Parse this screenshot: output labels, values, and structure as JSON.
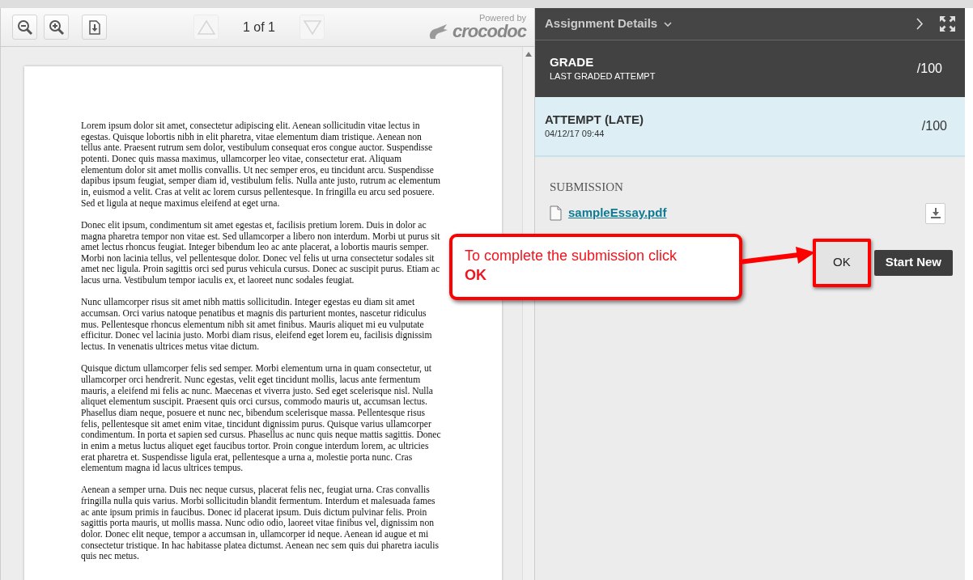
{
  "viewer": {
    "toolbar": {
      "page_indicator": "1 of 1",
      "prev_disabled": true,
      "next_disabled": true,
      "powered_by": "Powered by",
      "brand": "crocodoc"
    },
    "document": {
      "paragraphs": [
        "Lorem ipsum dolor sit amet, consectetur adipiscing elit. Aenean sollicitudin vitae lectus in egestas. Quisque lobortis nibh in elit pharetra, vitae elementum diam tristique. Aenean non tellus ante. Praesent rutrum sem dolor, vestibulum consequat eros congue auctor. Suspendisse potenti. Donec quis massa maximus, ullamcorper leo vitae, consectetur erat. Aliquam elementum dolor sit amet mollis convallis. Ut nec semper eros, eu tincidunt arcu. Suspendisse dapibus ipsum feugiat, semper diam id, vestibulum felis. Nulla ante justo, rutrum ac elementum in, euismod a velit. Cras at velit ac lorem cursus pellentesque. In fringilla eu arcu sed posuere. Sed et ligula at neque maximus eleifend at eget urna.",
        "Donec elit ipsum, condimentum sit amet egestas et, facilisis pretium lorem. Duis in dolor ac magna pharetra tempor non vitae est. Sed ullamcorper a libero non interdum. Morbi ut purus sit amet lectus rhoncus feugiat. Integer bibendum leo ac ante placerat, a lobortis mauris semper. Morbi non lacinia tellus, vel pellentesque dolor. Donec vel felis ut urna consectetur sodales sit amet nec ligula. Proin sagittis orci sed purus vehicula cursus. Donec ac suscipit purus. Etiam ac lacus urna. Vestibulum tempor iaculis ex, et laoreet nunc sodales feugiat.",
        "Nunc ullamcorper risus sit amet nibh mattis sollicitudin. Integer egestas eu diam sit amet accumsan. Orci varius natoque penatibus et magnis dis parturient montes, nascetur ridiculus mus. Pellentesque rhoncus elementum nibh sit amet finibus. Mauris aliquet mi eu vulputate efficitur. Donec vel lacinia justo. Morbi diam risus, eleifend eget lorem eu, facilisis dignissim lectus. In venenatis ultrices metus vitae dictum.",
        "Quisque dictum ullamcorper felis sed semper. Morbi elementum urna in quam consectetur, ut ullamcorper orci hendrerit. Nunc egestas, velit eget tincidunt mollis, lacus ante fermentum mauris, a eleifend mi felis ac nunc. Maecenas et viverra justo. Sed eget scelerisque nisl. Nulla aliquet elementum suscipit. Praesent quis orci cursus, commodo mauris ut, accumsan lectus. Phasellus diam neque, posuere et nunc nec, bibendum scelerisque massa. Pellentesque risus felis, pellentesque sit amet enim vitae, tincidunt dignissim purus. Quisque varius ullamcorper condimentum. In porta et sapien sed cursus. Phasellus ac nunc quis neque mattis sagittis. Donec in enim a metus luctus aliquet eget faucibus tortor. Proin congue interdum lorem, ac ultricies erat pharetra et. Suspendisse ligula erat, pellentesque a urna a, molestie porta nunc. Cras elementum magna id lacus ultrices tempus.",
        "Aenean a semper urna. Duis nec neque cursus, placerat felis nec, feugiat urna. Cras convallis fringilla nulla quis varius. Morbi sollicitudin blandit fermentum. Interdum et malesuada fames ac ante ipsum primis in faucibus. Donec id placerat ipsum. Duis dictum pulvinar felis. Proin sagittis porta mauris, ut mollis massa. Nunc odio odio, laoreet vitae finibus vel, dignissim non dolor. Donec elit neque, tempor a accumsan in, ullamcorper id neque. Aenean id augue et mi consectetur tristique. In hac habitasse platea dictumst. Aenean nec sem quis dui pharetra iaculis quis nec metus."
      ]
    }
  },
  "panel": {
    "title": "Assignment Details",
    "grade": {
      "label": "GRADE",
      "sublabel": "LAST GRADED ATTEMPT",
      "score": "/100"
    },
    "attempts": [
      {
        "label": "ATTEMPT (LATE)",
        "date": "04/12/17 09:44",
        "score": "/100",
        "selected": true
      }
    ],
    "submission": {
      "heading": "SUBMISSION",
      "file": "sampleEssay.pdf"
    },
    "buttons": [
      {
        "label": "OK",
        "kind": "ok",
        "highlighted": true
      },
      {
        "label": "Start New",
        "kind": "primary",
        "highlighted": false
      }
    ]
  },
  "callout": {
    "text": "To complete the submission click\n**OK**"
  }
}
